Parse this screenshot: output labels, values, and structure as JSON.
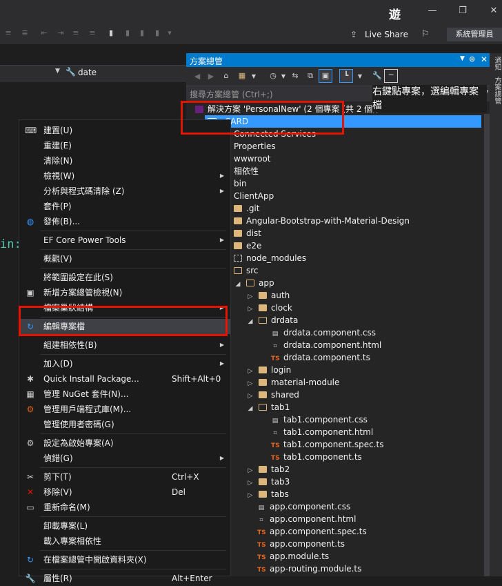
{
  "titlebar": {
    "logo": "遊",
    "minimize": "—",
    "restore": "❐",
    "close": "✕"
  },
  "toolbar": {
    "live_share": "Live Share",
    "admin": "系統管理員"
  },
  "navbar": {
    "member": "date"
  },
  "editor": {
    "code_fragment": "in:"
  },
  "solution_explorer": {
    "title": "方案總管",
    "pin": "⊕",
    "search_placeholder": "搜尋方案總管 (Ctrl+;)",
    "annotation": "右鍵點專案，選編輯專案檔",
    "solution_label": "解決方案 'PersonalNew' (2 個專案 (共 2 個))",
    "project_label": "CARD",
    "items": [
      {
        "label": "Connected Services",
        "indent": 0,
        "icon": "none"
      },
      {
        "label": "Properties",
        "indent": 0,
        "icon": "none"
      },
      {
        "label": "wwwroot",
        "indent": 0,
        "icon": "none"
      },
      {
        "label": "相依性",
        "indent": 0,
        "icon": "none"
      },
      {
        "label": "bin",
        "indent": 0,
        "icon": "none"
      },
      {
        "label": "ClientApp",
        "indent": 0,
        "icon": "none"
      },
      {
        "label": ".git",
        "indent": 0,
        "icon": "folder"
      },
      {
        "label": "Angular-Bootstrap-with-Material-Design",
        "indent": 0,
        "icon": "folder"
      },
      {
        "label": "dist",
        "indent": 0,
        "icon": "folder"
      },
      {
        "label": "e2e",
        "indent": 0,
        "icon": "folder"
      },
      {
        "label": "node_modules",
        "indent": 0,
        "icon": "folder-dashed"
      },
      {
        "label": "src",
        "indent": 0,
        "icon": "folder-open"
      },
      {
        "label": "app",
        "indent": 1,
        "icon": "folder-open",
        "arrow": "open"
      },
      {
        "label": "auth",
        "indent": 2,
        "icon": "folder",
        "arrow": "closed"
      },
      {
        "label": "clock",
        "indent": 2,
        "icon": "folder",
        "arrow": "closed"
      },
      {
        "label": "drdata",
        "indent": 2,
        "icon": "folder-open",
        "arrow": "open"
      },
      {
        "label": "drdata.component.css",
        "indent": 3,
        "icon": "css"
      },
      {
        "label": "drdata.component.html",
        "indent": 3,
        "icon": "html"
      },
      {
        "label": "drdata.component.ts",
        "indent": 3,
        "icon": "ts"
      },
      {
        "label": "login",
        "indent": 2,
        "icon": "folder",
        "arrow": "closed"
      },
      {
        "label": "material-module",
        "indent": 2,
        "icon": "folder",
        "arrow": "closed"
      },
      {
        "label": "shared",
        "indent": 2,
        "icon": "folder",
        "arrow": "closed"
      },
      {
        "label": "tab1",
        "indent": 2,
        "icon": "folder-open",
        "arrow": "open"
      },
      {
        "label": "tab1.component.css",
        "indent": 3,
        "icon": "css"
      },
      {
        "label": "tab1.component.html",
        "indent": 3,
        "icon": "html"
      },
      {
        "label": "tab1.component.spec.ts",
        "indent": 3,
        "icon": "ts"
      },
      {
        "label": "tab1.component.ts",
        "indent": 3,
        "icon": "ts"
      },
      {
        "label": "tab2",
        "indent": 2,
        "icon": "folder",
        "arrow": "closed"
      },
      {
        "label": "tab3",
        "indent": 2,
        "icon": "folder",
        "arrow": "closed"
      },
      {
        "label": "tabs",
        "indent": 2,
        "icon": "folder",
        "arrow": "closed"
      },
      {
        "label": "app.component.css",
        "indent": 2,
        "icon": "css"
      },
      {
        "label": "app.component.html",
        "indent": 2,
        "icon": "html"
      },
      {
        "label": "app.component.spec.ts",
        "indent": 2,
        "icon": "ts"
      },
      {
        "label": "app.component.ts",
        "indent": 2,
        "icon": "ts"
      },
      {
        "label": "app.module.ts",
        "indent": 2,
        "icon": "ts"
      },
      {
        "label": "app-routing.module.ts",
        "indent": 2,
        "icon": "ts"
      }
    ]
  },
  "right_strip": {
    "tab1": "通知",
    "tab2": "方案總管"
  },
  "context_menu": {
    "items": [
      {
        "label": "建置(U)",
        "icon": "build-icon"
      },
      {
        "label": "重建(E)"
      },
      {
        "label": "清除(N)"
      },
      {
        "label": "檢視(W)",
        "submenu": true
      },
      {
        "label": "分析與程式碼清除 (Z)",
        "submenu": true
      },
      {
        "label": "套件(P)"
      },
      {
        "label": "發佈(B)...",
        "icon": "globe-icon"
      },
      {
        "sep": true
      },
      {
        "label": "EF Core Power Tools",
        "submenu": true
      },
      {
        "sep": true
      },
      {
        "label": "概觀(V)"
      },
      {
        "sep": true
      },
      {
        "label": "將範圍設定在此(S)"
      },
      {
        "label": "新增方案總管檢視(N)",
        "icon": "new-view-icon"
      },
      {
        "label": "檔案巢狀結構",
        "submenu": true
      },
      {
        "sep": true
      },
      {
        "label": "編輯專案檔",
        "icon": "edit-project-icon",
        "highlight": true
      },
      {
        "sep": true
      },
      {
        "label": "組建相依性(B)",
        "submenu": true
      },
      {
        "sep": true
      },
      {
        "label": "加入(D)",
        "submenu": true
      },
      {
        "label": "Quick Install Package...",
        "shortcut": "Shift+Alt+0",
        "icon": "package-icon"
      },
      {
        "label": "管理 NuGet 套件(N)...",
        "icon": "nuget-icon"
      },
      {
        "label": "管理用戶端程式庫(M)...",
        "icon": "library-icon"
      },
      {
        "label": "管理使用者密碼(G)"
      },
      {
        "sep": true
      },
      {
        "label": "設定為啟始專案(A)",
        "icon": "gear-icon"
      },
      {
        "label": "偵錯(G)",
        "submenu": true
      },
      {
        "sep": true
      },
      {
        "label": "剪下(T)",
        "shortcut": "Ctrl+X",
        "icon": "scissors-icon"
      },
      {
        "label": "移除(V)",
        "shortcut": "Del",
        "icon": "remove-icon"
      },
      {
        "label": "重新命名(M)",
        "icon": "rename-icon"
      },
      {
        "sep": true
      },
      {
        "label": "卸載專案(L)"
      },
      {
        "label": "載入專案相依性"
      },
      {
        "sep": true
      },
      {
        "label": "在檔案總管中開啟資料夾(X)",
        "icon": "refresh-icon"
      },
      {
        "sep": true
      },
      {
        "label": "屬性(R)",
        "shortcut": "Alt+Enter",
        "icon": "wrench-icon"
      }
    ]
  },
  "colors": {
    "accent": "#007acc",
    "highlight": "#e51400",
    "selected": "#3399ff"
  }
}
